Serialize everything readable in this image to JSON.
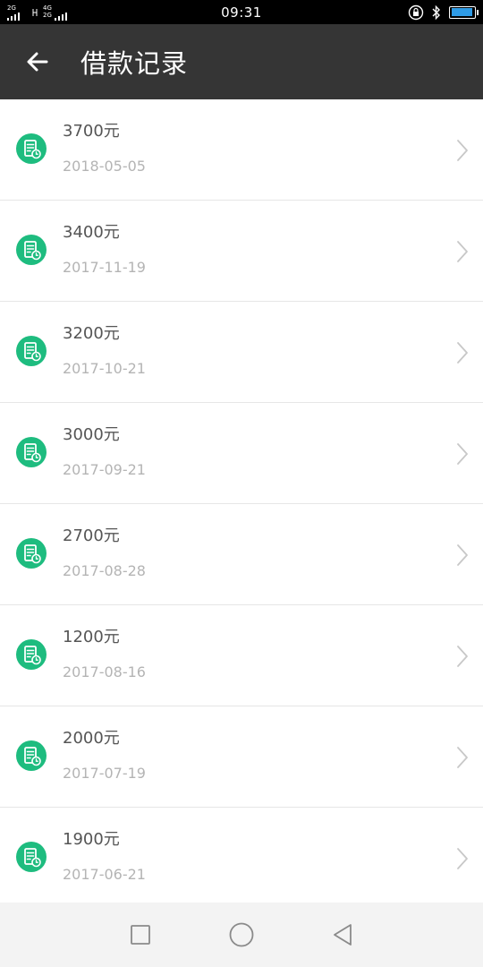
{
  "status_bar": {
    "time": "09:31",
    "sim1_label": "2G",
    "sim2_label_top": "4G",
    "sim2_label_bottom": "2G",
    "battery_level": 0.95,
    "battery_color": "#2e9be6"
  },
  "header": {
    "title": "借款记录",
    "back_icon": "arrow-left-icon"
  },
  "records": [
    {
      "amount": "3700元",
      "date": "2018-05-05"
    },
    {
      "amount": "3400元",
      "date": "2017-11-19"
    },
    {
      "amount": "3200元",
      "date": "2017-10-21"
    },
    {
      "amount": "3000元",
      "date": "2017-09-21"
    },
    {
      "amount": "2700元",
      "date": "2017-08-28"
    },
    {
      "amount": "1200元",
      "date": "2017-08-16"
    },
    {
      "amount": "2000元",
      "date": "2017-07-19"
    },
    {
      "amount": "1900元",
      "date": "2017-06-21"
    }
  ],
  "colors": {
    "header_bg": "#353535",
    "icon_green": "#1ebc7f",
    "amount_text": "#555555",
    "date_text": "#b4b4b4"
  },
  "nav": {
    "recent_icon": "square-icon",
    "home_icon": "circle-icon",
    "back_icon": "triangle-back-icon"
  }
}
